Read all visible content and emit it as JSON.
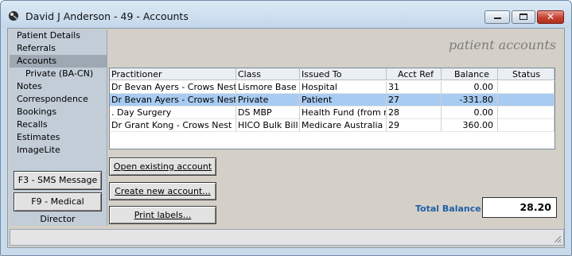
{
  "window": {
    "title": "David J Anderson - 49 - Accounts"
  },
  "sidebar": {
    "items": [
      {
        "label": "Patient Details"
      },
      {
        "label": "Referrals"
      },
      {
        "label": "Accounts"
      },
      {
        "label": "Private (BA-CN)"
      },
      {
        "label": "Notes"
      },
      {
        "label": "Correspondence"
      },
      {
        "label": "Bookings"
      },
      {
        "label": "Recalls"
      },
      {
        "label": "Estimates"
      },
      {
        "label": "ImageLite"
      }
    ],
    "buttons": {
      "sms": "F3 - SMS Message",
      "medical_director": "F9 - Medical Director"
    }
  },
  "main": {
    "heading": "patient accounts",
    "table": {
      "columns": [
        "Practitioner",
        "Class",
        "Issued To",
        "Acct Ref",
        "Balance",
        "Status"
      ],
      "rows": [
        [
          "Dr Bevan Ayers - Crows Nest",
          "Lismore Base",
          "Hospital",
          "31",
          "0.00",
          ""
        ],
        [
          "Dr Bevan Ayers - Crows Nest",
          "Private",
          "Patient",
          "27",
          "-331.80",
          ""
        ],
        [
          ". Day Surgery",
          "DS MBP",
          "Health Fund (from mem",
          "28",
          "0.00",
          ""
        ],
        [
          "Dr Grant Kong - Crows Nest",
          "HICO Bulk Bill",
          "Medicare Australia Direc",
          "29",
          "360.00",
          ""
        ]
      ]
    },
    "buttons": {
      "open_existing": "Open existing account",
      "create_new": "Create new account...",
      "print_labels": "Print labels..."
    },
    "total": {
      "label": "Total Balance",
      "value": "28.20"
    }
  },
  "colors": {
    "accent": "#1f5fa6",
    "selection": "#a8cbf1",
    "close_button": "#c4412f"
  }
}
